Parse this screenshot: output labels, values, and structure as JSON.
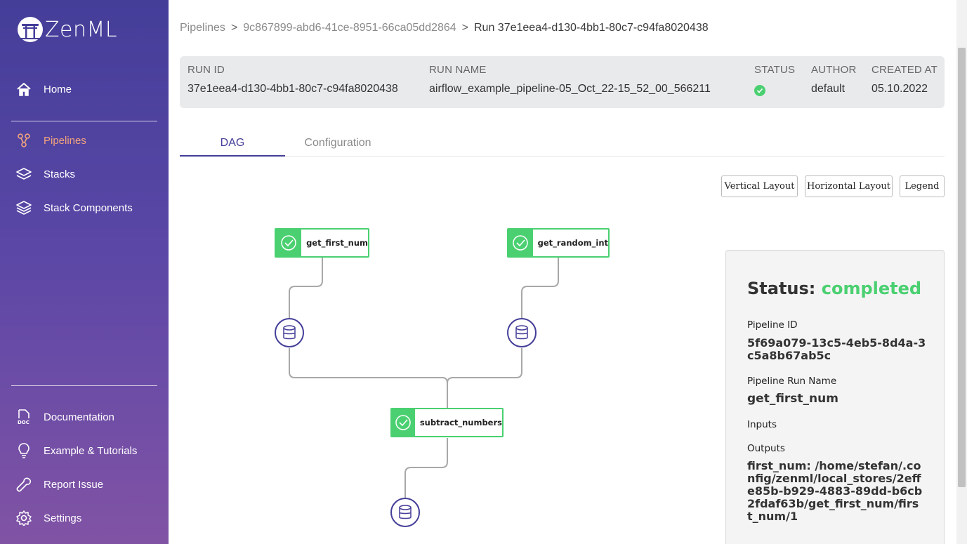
{
  "app": {
    "logo_text": "ZenML"
  },
  "sidebar": {
    "top_items": [
      {
        "label": "Home",
        "icon": "home-icon"
      },
      {
        "label": "Pipelines",
        "icon": "pipelines-icon",
        "active": true
      },
      {
        "label": "Stacks",
        "icon": "stacks-icon"
      },
      {
        "label": "Stack Components",
        "icon": "stack-components-icon"
      }
    ],
    "bottom_items": [
      {
        "label": "Documentation",
        "icon": "doc-icon"
      },
      {
        "label": "Example & Tutorials",
        "icon": "lightbulb-icon"
      },
      {
        "label": "Report Issue",
        "icon": "wrench-icon"
      },
      {
        "label": "Settings",
        "icon": "gear-icon"
      }
    ],
    "active_color": "#f2a47c"
  },
  "breadcrumb": {
    "root": "Pipelines",
    "pipeline": "9c867899-abd6-41ce-8951-66ca05dd2864",
    "current": "Run 37e1eea4-d130-4bb1-80c7-c94fa8020438"
  },
  "run_info": {
    "run_id_label": "RUN ID",
    "run_id": "37e1eea4-d130-4bb1-80c7-c94fa8020438",
    "run_name_label": "RUN NAME",
    "run_name": "airflow_example_pipeline-05_Oct_22-15_52_00_566211",
    "status_label": "STATUS",
    "status": "completed",
    "author_label": "AUTHOR",
    "author": "default",
    "created_label": "CREATED AT",
    "created": "05.10.2022"
  },
  "tabs": [
    {
      "label": "DAG",
      "active": true
    },
    {
      "label": "Configuration",
      "active": false
    }
  ],
  "layout_buttons": {
    "vertical": "Vertical Layout",
    "horizontal": "Horizontal Layout",
    "legend": "Legend"
  },
  "dag": {
    "steps": [
      {
        "name": "get_first_num",
        "status": "completed"
      },
      {
        "name": "get_random_int",
        "status": "completed"
      },
      {
        "name": "subtract_numbers",
        "status": "completed"
      }
    ],
    "artifact_icon": "database-icon",
    "step_color": "#4bd071",
    "artifact_color": "#443e99"
  },
  "details": {
    "status_prefix": "Status:",
    "status_value": "completed",
    "pipeline_id_label": "Pipeline ID",
    "pipeline_id": "5f69a079-13c5-4eb5-8d4a-3c5a8b67ab5c",
    "run_name_label": "Pipeline Run Name",
    "run_name": "get_first_num",
    "inputs_label": "Inputs",
    "outputs_label": "Outputs",
    "outputs_value": "first_num: /home/stefan/.config/zenml/local_stores/2effe85b-b929-4883-89dd-b6cb2fdaf63b/get_first_num/first_num/1"
  }
}
